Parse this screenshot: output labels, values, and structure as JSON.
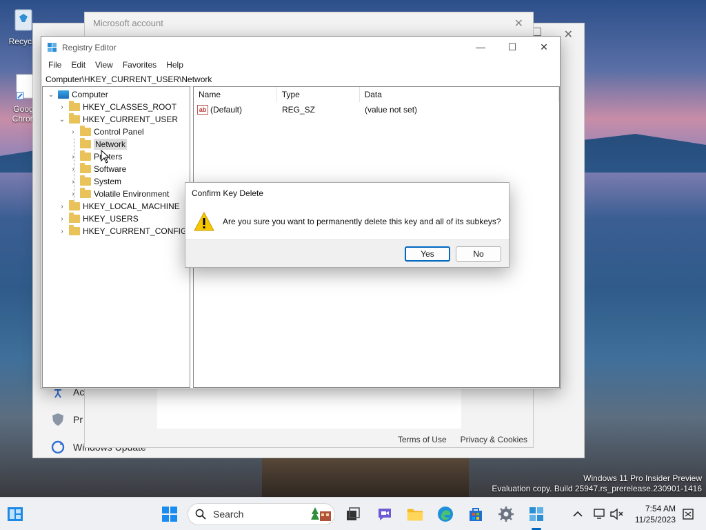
{
  "desktop": {
    "icons": [
      {
        "label": "Recycle"
      },
      {
        "label": "Goog Chron"
      }
    ],
    "watermark": {
      "line1": "Windows 11 Pro Insider Preview",
      "line2": "Evaluation copy. Build 25947.rs_prerelease.230901-1416"
    }
  },
  "settings_window": {
    "items": [
      {
        "label": "Ac",
        "icon": "accessibility-icon"
      },
      {
        "label": "Pr",
        "icon": "shield-icon"
      },
      {
        "label": "Windows Update",
        "icon": "windows-update-icon"
      }
    ]
  },
  "ms_account_window": {
    "title": "Microsoft account",
    "footer": {
      "terms": "Terms of Use",
      "privacy": "Privacy & Cookies"
    }
  },
  "regedit": {
    "title": "Registry Editor",
    "menu": [
      "File",
      "Edit",
      "View",
      "Favorites",
      "Help"
    ],
    "address": "Computer\\HKEY_CURRENT_USER\\Network",
    "tree": [
      {
        "label": "Computer",
        "level": 0,
        "expanded": true,
        "type": "computer"
      },
      {
        "label": "HKEY_CLASSES_ROOT",
        "level": 1,
        "expanded": false
      },
      {
        "label": "HKEY_CURRENT_USER",
        "level": 1,
        "expanded": true
      },
      {
        "label": "Control Panel",
        "level": 2,
        "expanded": false
      },
      {
        "label": "Network",
        "level": 2,
        "selected": true
      },
      {
        "label": "Printers",
        "level": 2,
        "expanded": false
      },
      {
        "label": "Software",
        "level": 2,
        "expanded": false
      },
      {
        "label": "System",
        "level": 2,
        "expanded": false
      },
      {
        "label": "Volatile Environment",
        "level": 2,
        "expanded": false
      },
      {
        "label": "HKEY_LOCAL_MACHINE",
        "level": 1,
        "expanded": false
      },
      {
        "label": "HKEY_USERS",
        "level": 1,
        "expanded": false
      },
      {
        "label": "HKEY_CURRENT_CONFIG",
        "level": 1,
        "expanded": false
      }
    ],
    "columns": [
      "Name",
      "Type",
      "Data"
    ],
    "values": [
      {
        "name": "(Default)",
        "type": "REG_SZ",
        "data": "(value not set)"
      }
    ]
  },
  "dialog": {
    "title": "Confirm Key Delete",
    "message": "Are you sure you want to permanently delete this key and all of its subkeys?",
    "yes": "Yes",
    "no": "No"
  },
  "taskbar": {
    "search_label": "Search",
    "time": "7:54 AM",
    "date": "11/25/2023",
    "apps": [
      "widgets-icon",
      "start-icon",
      "game-icon",
      "task-view-icon",
      "meet-icon",
      "file-explorer-icon",
      "edge-icon",
      "store-icon",
      "settings-icon",
      "registry-editor-icon"
    ]
  }
}
